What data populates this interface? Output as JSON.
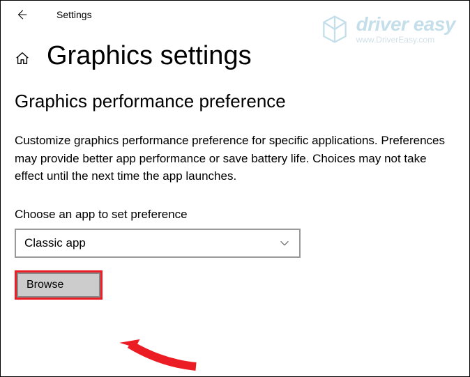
{
  "topbar": {
    "title": "Settings"
  },
  "page": {
    "title": "Graphics settings"
  },
  "section": {
    "heading": "Graphics performance preference",
    "description": "Customize graphics performance preference for specific applications. Preferences may provide better app performance or save battery life. Choices may not take effect until the next time the app launches.",
    "choose_label": "Choose an app to set preference"
  },
  "dropdown": {
    "selected": "Classic app"
  },
  "buttons": {
    "browse": "Browse"
  },
  "watermark": {
    "main": "driver easy",
    "sub": "www.DriverEasy.com"
  }
}
